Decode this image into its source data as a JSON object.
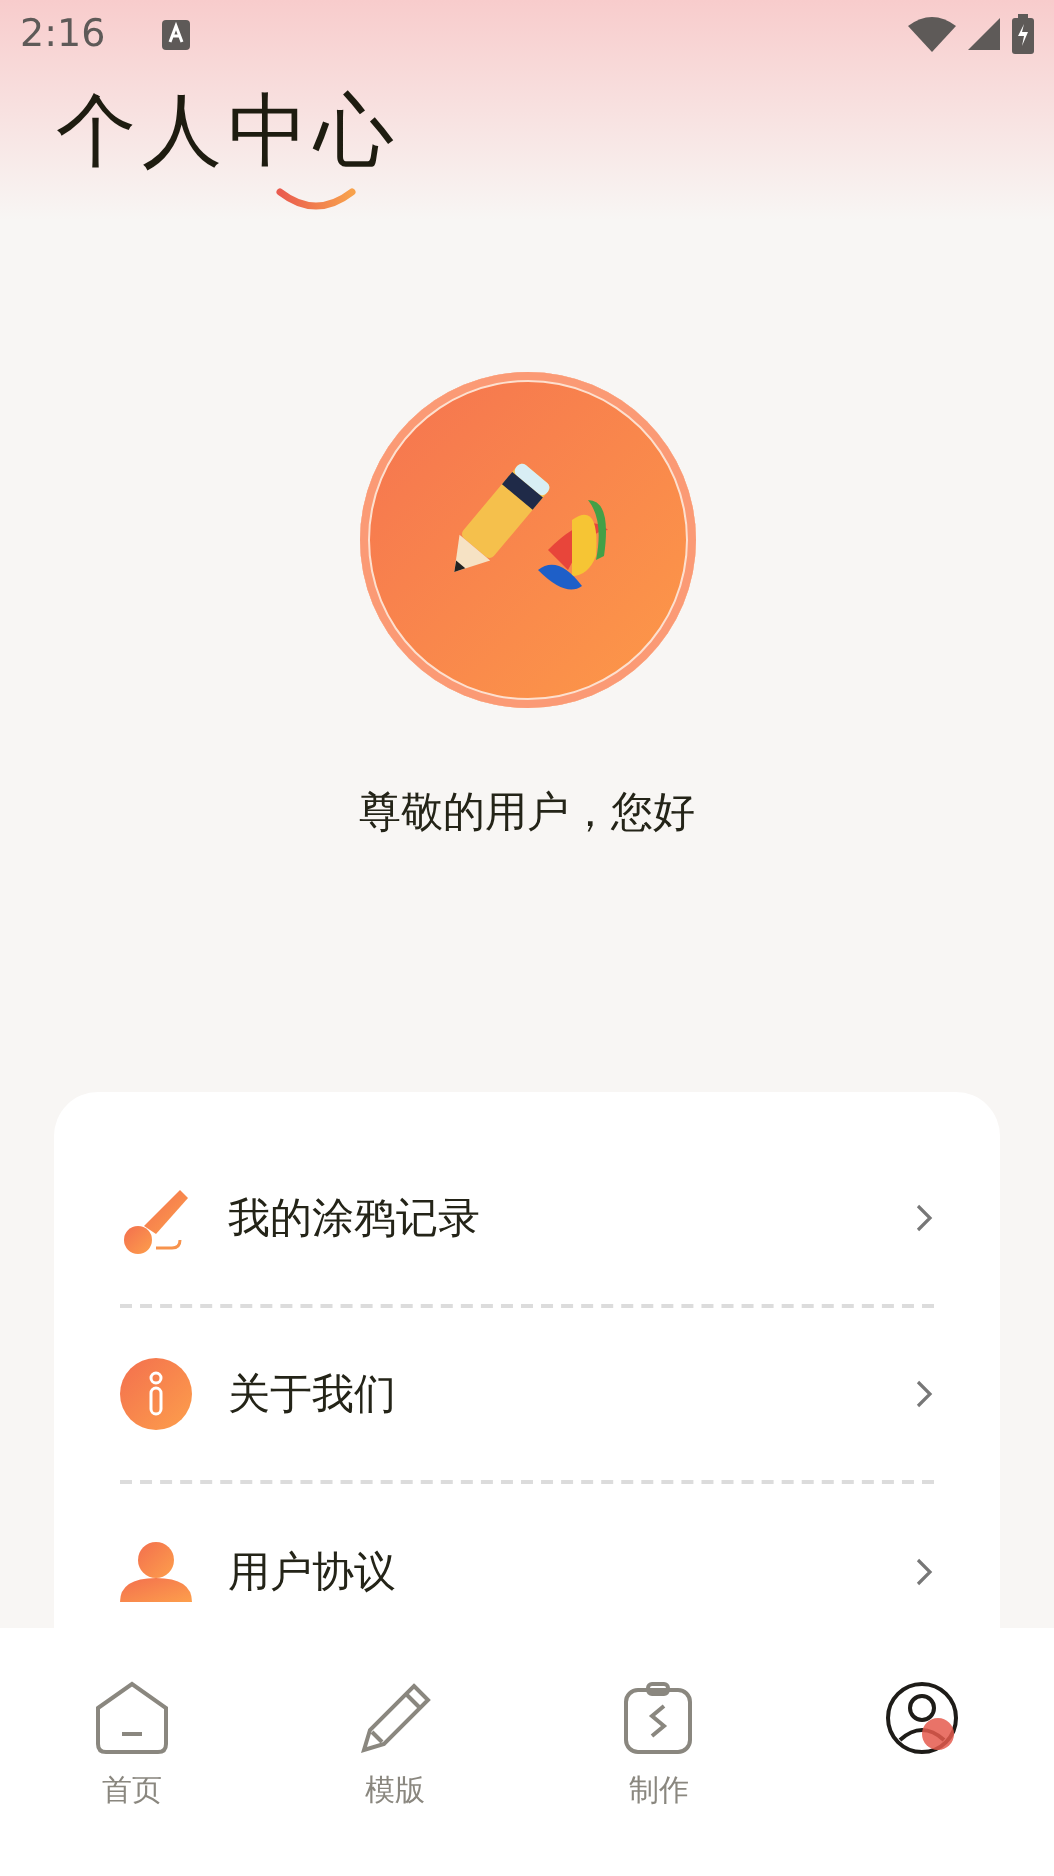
{
  "status_bar": {
    "time": "2:16"
  },
  "title": "个人中心",
  "greeting": "尊敬的用户，您好",
  "menu": [
    {
      "kind": "doodle",
      "label": "我的涂鸦记录"
    },
    {
      "kind": "info",
      "label": "关于我们"
    },
    {
      "kind": "user",
      "label": "用户协议"
    }
  ],
  "tabs": [
    {
      "kind": "home",
      "label": "首页",
      "selected": false
    },
    {
      "kind": "pencil",
      "label": "模版",
      "selected": false
    },
    {
      "kind": "clipboard",
      "label": "制作",
      "selected": false
    },
    {
      "kind": "profile",
      "selected": true
    }
  ]
}
